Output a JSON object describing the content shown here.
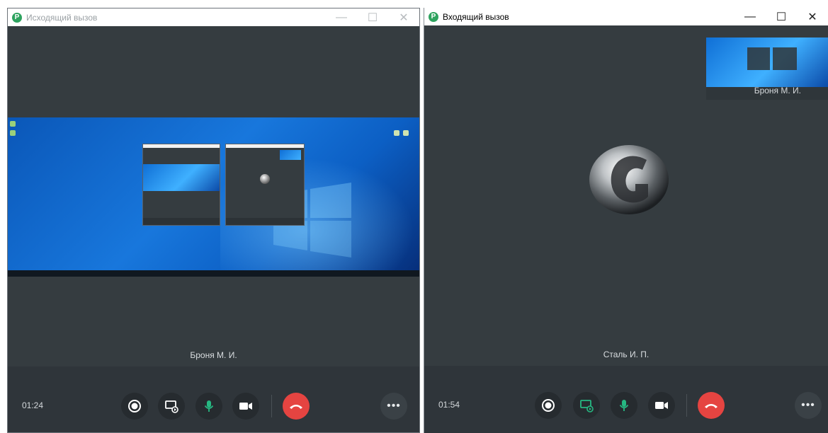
{
  "left_window": {
    "title": "Исходящий вызов",
    "controls": {
      "minimize": "—",
      "maximize": "☐",
      "close": "✕"
    },
    "caller_name": "Броня М. И.",
    "timer": "01:24",
    "shared_content": "screen-share"
  },
  "right_window": {
    "title": "Входящий вызов",
    "controls": {
      "minimize": "—",
      "maximize": "☐",
      "close": "✕"
    },
    "self_preview_name": "Броня М. И.",
    "caller_name": "Сталь И. П.",
    "timer": "01:54"
  },
  "toolbar": {
    "buttons": [
      {
        "name": "record",
        "icon": "record-icon"
      },
      {
        "name": "share-screen",
        "icon": "share-screen-icon"
      },
      {
        "name": "microphone",
        "icon": "microphone-icon",
        "active": true
      },
      {
        "name": "camera",
        "icon": "camera-icon"
      },
      {
        "name": "hang-up",
        "icon": "phone-hangup-icon"
      },
      {
        "name": "more",
        "icon": "more-icon"
      }
    ],
    "more_label": "•••"
  },
  "colors": {
    "window_bg": "#353c40",
    "control_bar": "#2f353a",
    "button_bg": "#262b2f",
    "accent_green": "#26b882",
    "hangup_red": "#e54441"
  }
}
